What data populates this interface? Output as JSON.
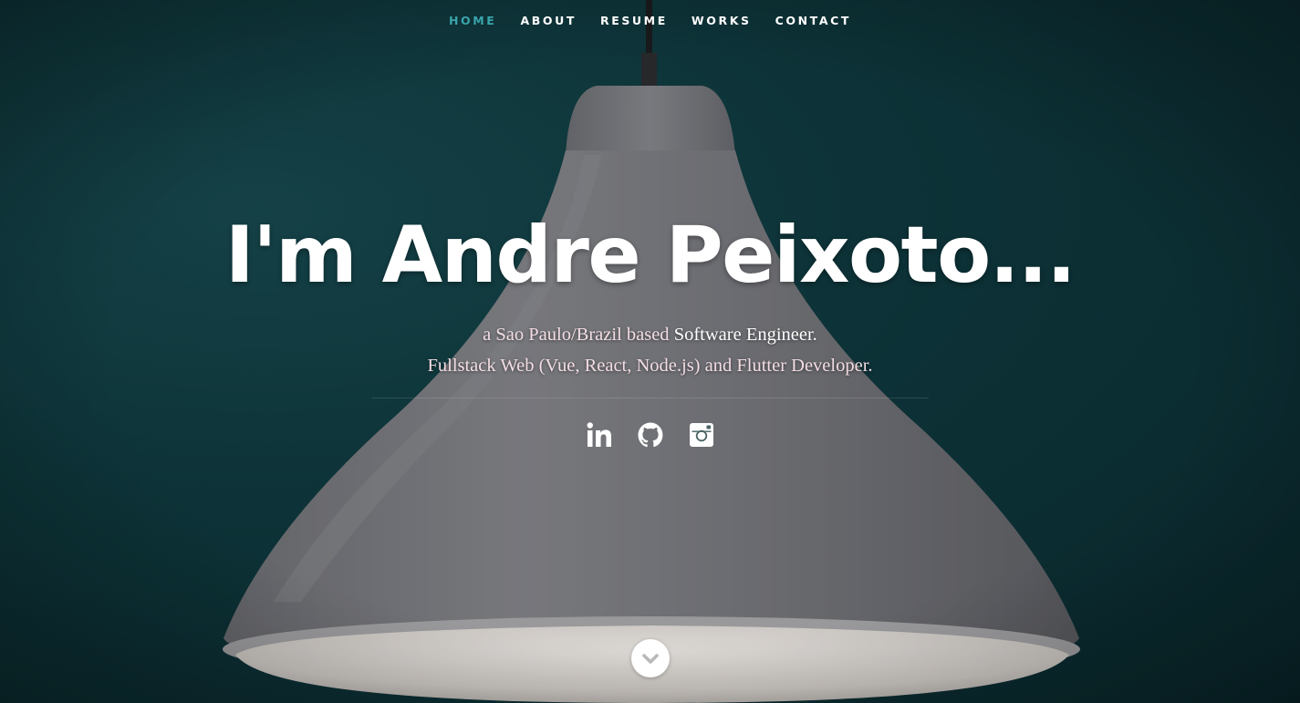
{
  "nav": {
    "items": [
      {
        "label": "HOME",
        "active": true
      },
      {
        "label": "ABOUT",
        "active": false
      },
      {
        "label": "RESUME",
        "active": false
      },
      {
        "label": "WORKS",
        "active": false
      },
      {
        "label": "CONTACT",
        "active": false
      }
    ]
  },
  "banner": {
    "headline": "I'm Andre Peixoto...",
    "line1_prefix": "a Sao Paulo/Brazil based ",
    "line1_strong": "Software Engineer.",
    "line2": "Fullstack Web (Vue, React, Node.js) and Flutter Developer."
  },
  "social": [
    {
      "icon": "linkedin-icon"
    },
    {
      "icon": "github-icon"
    },
    {
      "icon": "instagram-icon"
    }
  ],
  "scroll": {
    "icon": "chevron-down-icon"
  },
  "colors": {
    "accent": "#3aa4ac",
    "background": "#0f383d",
    "text": "#ffffff",
    "subtitle": "#f3dde3"
  }
}
